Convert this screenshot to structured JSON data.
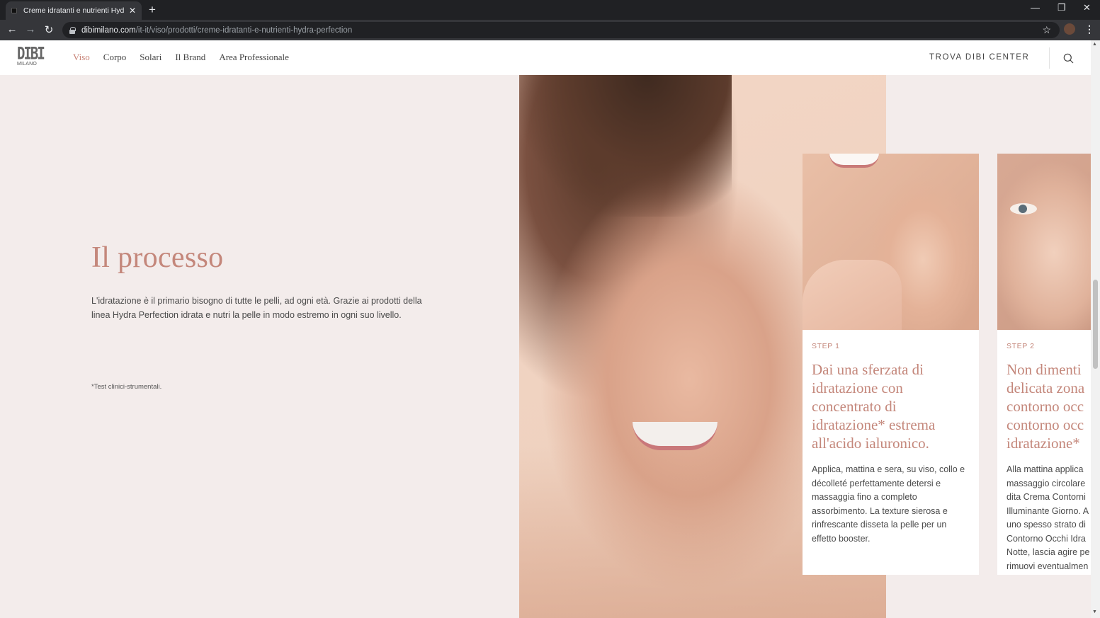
{
  "browser": {
    "tab_title": "Creme idratanti e nutrienti Hydra",
    "url_host": "dibimilano.com",
    "url_path": "/it-it/viso/prodotti/creme-idratanti-e-nutrienti-hydra-perfection"
  },
  "header": {
    "logo_main": "DIBI",
    "logo_sub": "MILANO",
    "nav": [
      "Viso",
      "Corpo",
      "Solari",
      "Il Brand",
      "Area Professionale"
    ],
    "active_nav": "Viso",
    "cta": "TROVA DIBI CENTER"
  },
  "process": {
    "title": "Il processo",
    "intro": "L'idratazione è il primario bisogno di tutte le pelli, ad ogni età. Grazie ai prodotti della linea Hydra Perfection idrata e nutri la pelle in modo estremo in ogni suo livello.",
    "footnote": "*Test clinici-strumentali.",
    "steps": [
      {
        "label": "STEP 1",
        "title_lines": [
          "Dai una sferzata di",
          "idratazione con",
          "concentrato di",
          "idratazione* estrema",
          "all'acido ialuronico."
        ],
        "text": "Applica, mattina e sera, su viso, collo e décolleté perfettamente detersi e massaggia fino a completo assorbimento. La texture sierosa e rinfrescante disseta la pelle per un effetto booster."
      },
      {
        "label": "STEP 2",
        "title_lines": [
          "Non dimenti",
          "delicata zona",
          "contorno occ",
          "contorno occ",
          "idratazione*"
        ],
        "text_lines": [
          "Alla mattina applica",
          "massaggio circolare",
          "dita Crema Contorni",
          "Illuminante Giorno. A",
          "uno spesso strato di",
          "Contorno Occhi Idra",
          "Notte, lascia agire pe",
          "rimuovi eventualmen"
        ]
      }
    ]
  }
}
